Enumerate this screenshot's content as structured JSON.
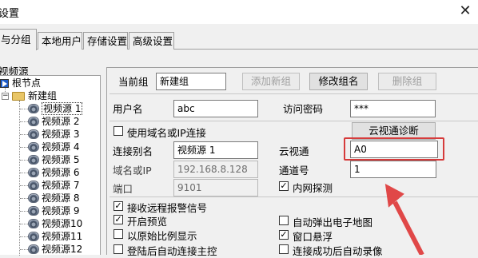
{
  "window": {
    "title": "设置",
    "close_glyph": "✕"
  },
  "tabs": [
    {
      "label": "与分组",
      "active": true
    },
    {
      "label": "本地用户",
      "active": false
    },
    {
      "label": "存储设置",
      "active": false
    },
    {
      "label": "高级设置",
      "active": false
    }
  ],
  "tree": {
    "header": "视频源",
    "root": "根节点",
    "group": "新建组",
    "items": [
      "视频源 1",
      "视频源 2",
      "视频源 3",
      "视频源 4",
      "视频源 5",
      "视频源 6",
      "视频源 7",
      "视频源 8",
      "视频源 9",
      "视频源10",
      "视频源11",
      "视频源12"
    ]
  },
  "group_bar": {
    "label": "当前组",
    "value": "新建组",
    "add_label": "添加新组",
    "rename_label": "修改组名",
    "delete_label": "删除组"
  },
  "user": {
    "username_label": "用户名",
    "username_value": "abc",
    "password_label": "访问密码",
    "password_value": "***"
  },
  "source": {
    "use_domain_label": "使用域名或IP连接",
    "diag_button": "云视通诊断",
    "alias_label": "连接别名",
    "alias_value": "视频源 1",
    "cloud_label": "云视通",
    "cloud_value": "A0",
    "domain_label": "域名或IP",
    "domain_value": "192.168.8.128",
    "channel_label": "通道号",
    "channel_value": "1",
    "port_label": "端口",
    "port_value": "9101",
    "lan_label": "内网探测",
    "lan_checked": true
  },
  "options": {
    "receive_alarm": "接收远程报警信号",
    "enable_preview": "开启预览",
    "original_ratio": "以原始比例显示",
    "auto_connect": "登陆后自动连接主控",
    "popup_map": "自动弹出电子地图",
    "float_window": "窗口悬浮",
    "auto_record": "连接成功后自动录像"
  },
  "colors": {
    "highlight_box": "#d63b3b",
    "arrow": "#e04848"
  }
}
